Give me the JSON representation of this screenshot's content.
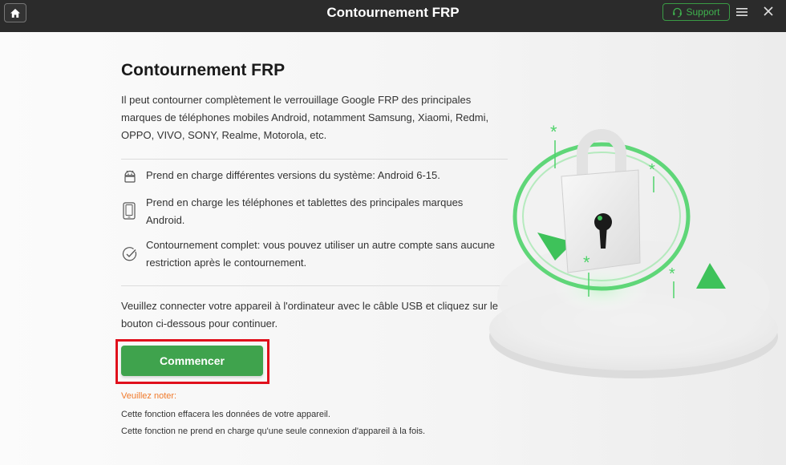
{
  "window": {
    "title": "Contournement FRP",
    "support_label": "Support"
  },
  "main": {
    "heading": "Contournement FRP",
    "description": "Il peut contourner complètement le verrouillage Google FRP des principales marques de téléphones mobiles Android, notamment Samsung, Xiaomi, Redmi, OPPO, VIVO, SONY, Realme, Motorola, etc.",
    "features": [
      {
        "icon": "android-icon",
        "text": "Prend en charge différentes versions du système: Android 6-15."
      },
      {
        "icon": "phone-tablet-icon",
        "text": "Prend en charge les téléphones et tablettes des principales marques Android."
      },
      {
        "icon": "check-circle-icon",
        "text": "Contournement complet: vous pouvez utiliser un autre compte sans aucune restriction après le contournement."
      }
    ],
    "instruction": "Veuillez connecter votre appareil à l'ordinateur avec le câble USB et cliquez sur le bouton ci-dessous pour continuer.",
    "start_label": "Commencer",
    "note": {
      "title": "Veuillez noter:",
      "lines": [
        "Cette fonction effacera les données de votre appareil.",
        "Cette fonction ne prend en charge qu'une seule connexion d'appareil à la fois."
      ]
    }
  },
  "colors": {
    "accent_green": "#3fa34d",
    "highlight_red": "#e0101c",
    "note_orange": "#f07a2b",
    "titlebar": "#2b2b2b"
  }
}
